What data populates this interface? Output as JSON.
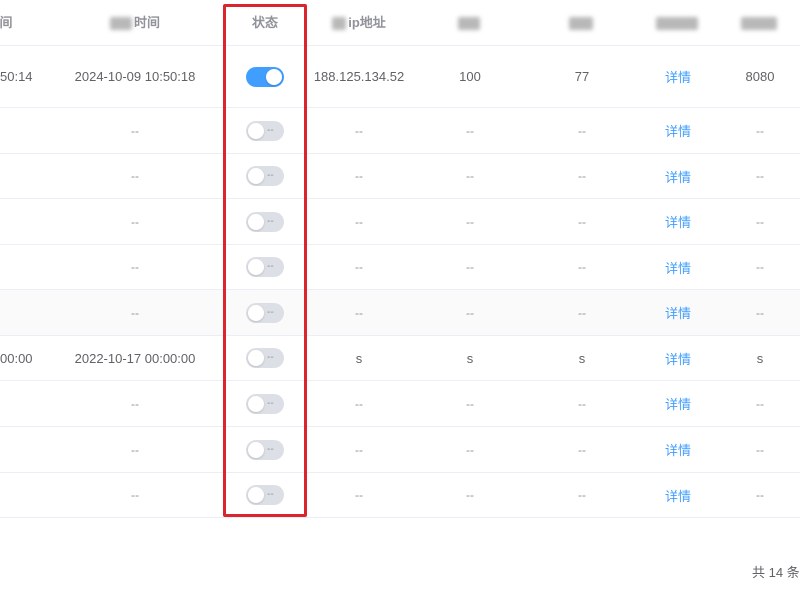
{
  "table": {
    "headers": {
      "col_a": "间",
      "col_time": "时间",
      "col_status": "状态",
      "col_ip": "ip地址",
      "col_link": "",
      "col_port": ""
    },
    "rows": [
      {
        "time_partial": "50:14",
        "time": "2024-10-09 10:50:18",
        "status_on": true,
        "switch_text": "",
        "ip": "188.125.134.52",
        "c5": "100",
        "c6": "77",
        "link": "详情",
        "port": "8080"
      },
      {
        "time_partial": "",
        "time": "--",
        "status_on": false,
        "switch_text": "--",
        "ip": "--",
        "c5": "--",
        "c6": "--",
        "link": "详情",
        "port": "--"
      },
      {
        "time_partial": "",
        "time": "--",
        "status_on": false,
        "switch_text": "--",
        "ip": "--",
        "c5": "--",
        "c6": "--",
        "link": "详情",
        "port": "--"
      },
      {
        "time_partial": "",
        "time": "--",
        "status_on": false,
        "switch_text": "--",
        "ip": "--",
        "c5": "--",
        "c6": "--",
        "link": "详情",
        "port": "--"
      },
      {
        "time_partial": "",
        "time": "--",
        "status_on": false,
        "switch_text": "--",
        "ip": "--",
        "c5": "--",
        "c6": "--",
        "link": "详情",
        "port": "--"
      },
      {
        "time_partial": "",
        "time": "--",
        "status_on": false,
        "switch_text": "--",
        "ip": "--",
        "c5": "--",
        "c6": "--",
        "link": "详情",
        "port": "--"
      },
      {
        "time_partial": "00:00",
        "time": "2022-10-17 00:00:00",
        "status_on": false,
        "switch_text": "--",
        "ip": "s",
        "c5": "s",
        "c6": "s",
        "link": "详情",
        "port": "s"
      },
      {
        "time_partial": "",
        "time": "--",
        "status_on": false,
        "switch_text": "--",
        "ip": "--",
        "c5": "--",
        "c6": "--",
        "link": "详情",
        "port": "--"
      },
      {
        "time_partial": "",
        "time": "--",
        "status_on": false,
        "switch_text": "--",
        "ip": "--",
        "c5": "--",
        "c6": "--",
        "link": "详情",
        "port": "--"
      },
      {
        "time_partial": "",
        "time": "--",
        "status_on": false,
        "switch_text": "--",
        "ip": "--",
        "c5": "--",
        "c6": "--",
        "link": "详情",
        "port": "--"
      }
    ]
  },
  "pagination": {
    "total_text": "共 14 条"
  },
  "colors": {
    "accent": "#409eff",
    "highlight": "#d9252b",
    "switch_off": "#dcdfe6"
  }
}
